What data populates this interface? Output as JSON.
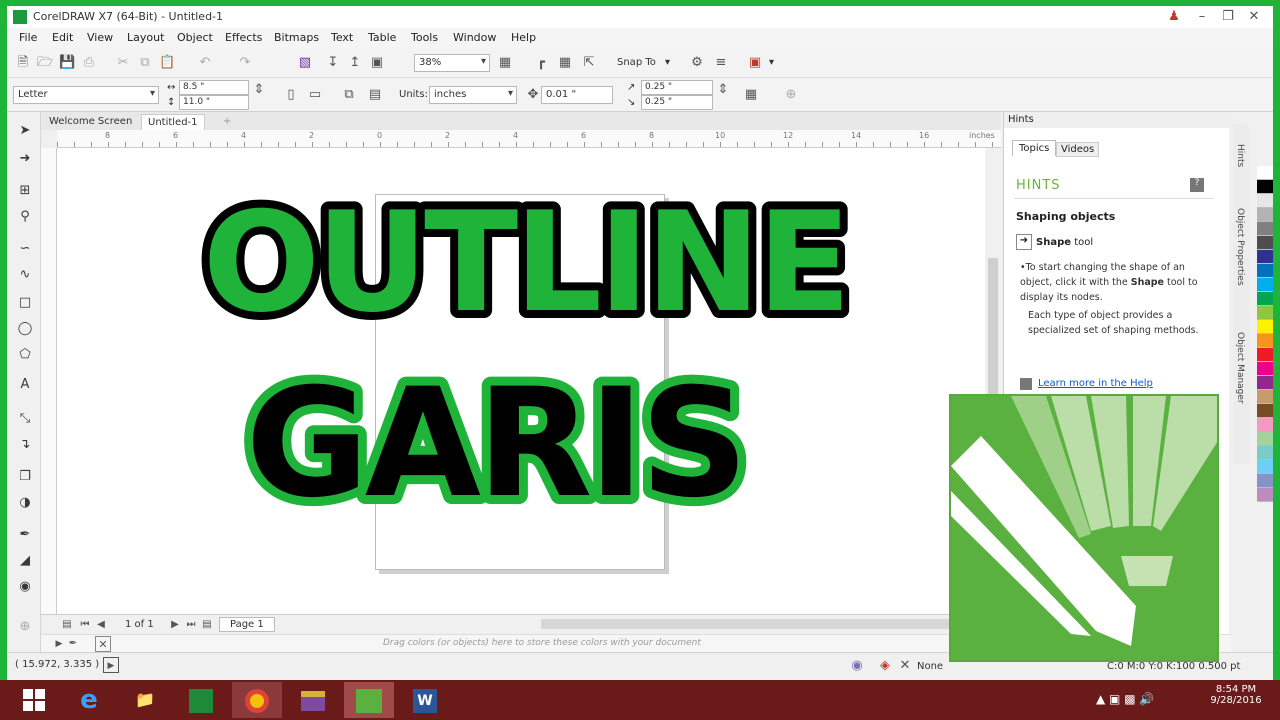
{
  "window": {
    "title": "CorelDRAW X7 (64-Bit) - Untitled-1"
  },
  "menus": [
    "File",
    "Edit",
    "View",
    "Layout",
    "Object",
    "Effects",
    "Bitmaps",
    "Text",
    "Table",
    "Tools",
    "Window",
    "Help"
  ],
  "toolbar": {
    "zoom": "38%",
    "snap_to": "Snap To"
  },
  "propbar": {
    "paper": "Letter",
    "width": "8.5 \"",
    "height": "11.0 \"",
    "units_label": "Units:",
    "units": "inches",
    "nudge": "0.01 \"",
    "dup_x": "0.25 \"",
    "dup_y": "0.25 \""
  },
  "doc_tabs": [
    "Welcome Screen",
    "Untitled-1"
  ],
  "ruler": {
    "labels": [
      "8",
      "6",
      "4",
      "2",
      "0",
      "2",
      "4",
      "6",
      "8",
      "10",
      "12",
      "14",
      "16"
    ],
    "unit": "inches"
  },
  "page_nav": {
    "count": "1 of 1",
    "page_tab": "Page 1"
  },
  "palette_hint": "Drag colors (or objects) here to store these colors with your document",
  "status": {
    "coords": "( 15.972, 3.335 )",
    "fill": "None",
    "outline": "C:0 M:0 Y:0 K:100  0.500 pt"
  },
  "dock": {
    "panel_title": "Hints",
    "tabs": [
      "Topics",
      "Videos"
    ],
    "hints_heading": "HINTS",
    "section_title": "Shaping objects",
    "tool_name": "Shape",
    "tool_suffix": "tool",
    "p1_a": "To start changing the shape of an object, click it with the ",
    "p1_tool": "Shape",
    "p1_b": " tool to display its nodes.",
    "p2": "Each type of object provides a specialized set of shaping methods.",
    "learn_more": "Learn more in the Help"
  },
  "vertical_tabs": [
    "Hints",
    "Object Properties",
    "Object Manager"
  ],
  "overlay": {
    "line1": "OUTLINE",
    "line2": "GARIS"
  },
  "clock": {
    "time": "8:54 PM",
    "date": "9/28/2016"
  },
  "colors": {
    "accent_green": "#1fb33a",
    "logo_green": "#5ab13f",
    "taskbar": "#6b1a1a",
    "palette": [
      "#ffffff",
      "#000000",
      "#e6e6e6",
      "#b3b3b3",
      "#808080",
      "#4d4d4d",
      "#2e3192",
      "#0072bc",
      "#00aeef",
      "#00a651",
      "#8dc63f",
      "#fff200",
      "#f7941d",
      "#ed1c24",
      "#ec008c",
      "#92278f",
      "#c69c6d",
      "#754c24",
      "#f49ac2",
      "#a3d39c",
      "#7accc8",
      "#6dcff6",
      "#8493ca",
      "#bd8cbf"
    ]
  },
  "icons": {
    "taskbar_apps": [
      "internet-explorer-icon",
      "file-explorer-icon",
      "store-icon",
      "chrome-icon",
      "winrar-icon",
      "coreldraw-icon",
      "word-icon"
    ]
  }
}
